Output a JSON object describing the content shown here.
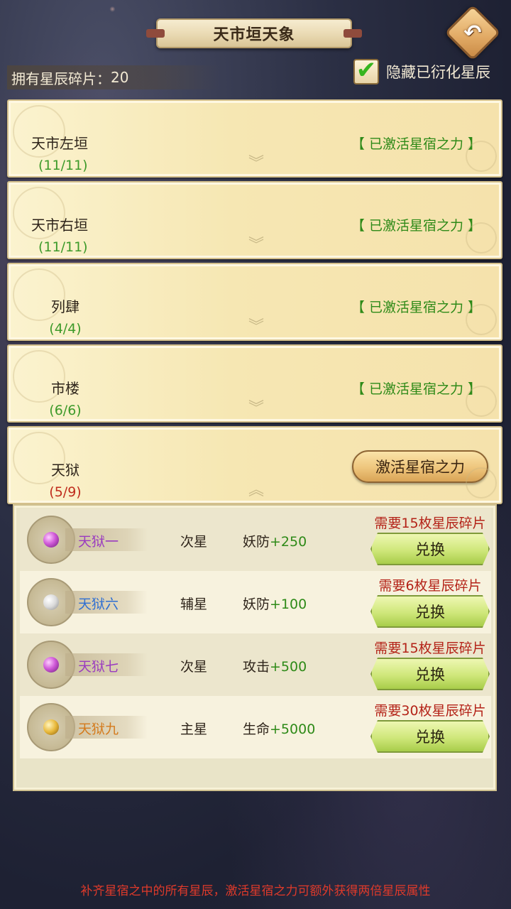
{
  "header": {
    "title": "天市垣天象",
    "back_icon": "back-arrow-icon"
  },
  "fragments": {
    "label": "拥有星辰碎片：",
    "value": "20"
  },
  "hide_toggle": {
    "label": "隐藏已衍化星辰",
    "checked": true
  },
  "groups": [
    {
      "name": "天市左垣",
      "count": "(11/11)",
      "status": "【 已激活星宿之力 】",
      "expanded": false
    },
    {
      "name": "天市右垣",
      "count": "(11/11)",
      "status": "【 已激活星宿之力 】",
      "expanded": false
    },
    {
      "name": "列肆",
      "count": "(4/4)",
      "status": "【 已激活星宿之力 】",
      "expanded": false
    },
    {
      "name": "市楼",
      "count": "(6/6)",
      "status": "【 已激活星宿之力 】",
      "expanded": false
    },
    {
      "name": "天狱",
      "count": "(5/9)",
      "action": "激活星宿之力",
      "expanded": true
    }
  ],
  "stars": [
    {
      "name": "天狱一",
      "type": "次星",
      "attr": "妖防",
      "attr_value": "+250",
      "cost": "需要15枚星辰碎片",
      "button": "兑换",
      "orb": "purple"
    },
    {
      "name": "天狱六",
      "type": "辅星",
      "attr": "妖防",
      "attr_value": "+100",
      "cost": "需要6枚星辰碎片",
      "button": "兑换",
      "orb": "white"
    },
    {
      "name": "天狱七",
      "type": "次星",
      "attr": "攻击",
      "attr_value": "+500",
      "cost": "需要15枚星辰碎片",
      "button": "兑换",
      "orb": "purple"
    },
    {
      "name": "天狱九",
      "type": "主星",
      "attr": "生命",
      "attr_value": "+5000",
      "cost": "需要30枚星辰碎片",
      "button": "兑换",
      "orb": "gold"
    }
  ],
  "footer": {
    "tip": "补齐星宿之中的所有星辰，激活星宿之力可额外获得两倍星辰属性"
  },
  "colors": {
    "active_status": "#2e8a18",
    "incomplete_count": "#c02c1c",
    "cost_text": "#b42318",
    "tip_text": "#e03a2a"
  }
}
